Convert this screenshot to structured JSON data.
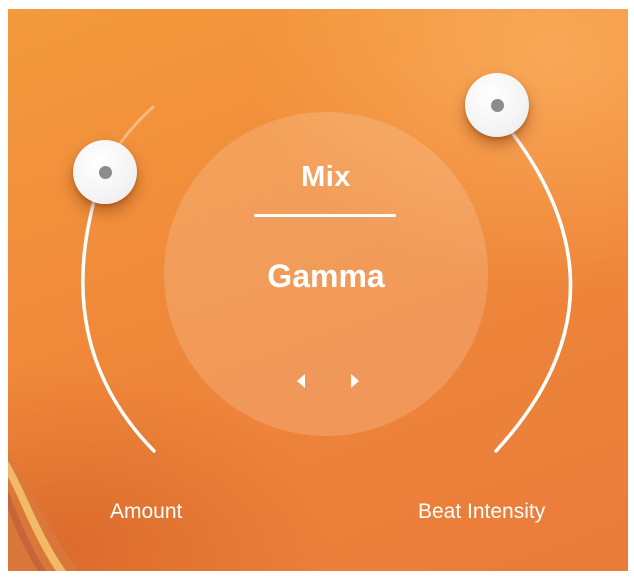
{
  "mix_panel": {
    "title": "Mix",
    "preset_name": "Gamma",
    "prev_icon": "caret-left-icon",
    "next_icon": "caret-right-icon"
  },
  "knobs": {
    "amount": {
      "label": "Amount",
      "icon": "knob-handle-icon"
    },
    "beat_intensity": {
      "label": "Beat Intensity",
      "icon": "knob-handle-icon"
    }
  },
  "colors": {
    "background": "#f0893a",
    "track": "#ffffff",
    "knob": "#ffffff",
    "knob_dot": "#8c8c8c"
  }
}
